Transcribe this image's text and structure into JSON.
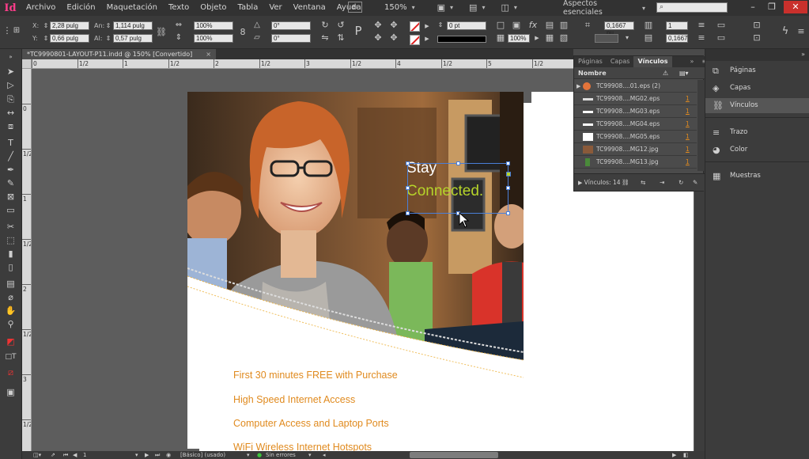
{
  "app": {
    "logo": "Id"
  },
  "menu": [
    "Archivo",
    "Edición",
    "Maquetación",
    "Texto",
    "Objeto",
    "Tabla",
    "Ver",
    "Ventana",
    "Ayuda"
  ],
  "menubar": {
    "bridge_label": "Br",
    "zoom": "150%",
    "workspace": "Aspectos esenciales",
    "search_placeholder": ""
  },
  "window_controls": {
    "minimize": "–",
    "restore": "❐",
    "close": "✕"
  },
  "control": {
    "x_label": "X:",
    "x_value": "2,28 pulg",
    "y_label": "Y:",
    "y_value": "0,66 pulg",
    "w_label": "An:",
    "w_value": "1,114 pulg",
    "h_label": "Al:",
    "h_value": "0,57 pulg",
    "scale_x": "100%",
    "scale_y": "100%",
    "rotate": "0°",
    "shear": "0°",
    "stroke_weight": "0 pt",
    "opacity": "100%",
    "gap": "0,1667 pu",
    "columns": "1",
    "gutter": "0,1667"
  },
  "document": {
    "tab_title": "*TC9990801-LAYOUT-P11.indd @ 150% [Convertido]",
    "tab_close": "×"
  },
  "ruler": {
    "h_labels": [
      "0",
      "1/2",
      "1",
      "1/2",
      "2",
      "1/2",
      "3",
      "1/2",
      "4",
      "1/2",
      "5",
      "1/2"
    ],
    "v_labels": [
      "0",
      "1/2",
      "1",
      "1/2",
      "2",
      "1/2",
      "3",
      "1/2"
    ]
  },
  "artwork": {
    "headline_1": "Stay",
    "headline_2": "Connected.",
    "promo_lines": [
      "First 30 minutes FREE with Purchase",
      "High Speed Internet Access",
      "Computer Access and Laptop Ports",
      "WiFi Wireless Internet Hotspots"
    ],
    "colors": {
      "promo": "#e08a1e",
      "connected": "#b6d42a"
    }
  },
  "links_panel": {
    "tabs": [
      "Páginas",
      "Capas",
      "Vínculos"
    ],
    "active_tab": "Vínculos",
    "expand_icon": "»",
    "menu_icon": "≡",
    "column_header": "Nombre",
    "rows": [
      {
        "name": "TC99908....01.eps (2)",
        "page": ""
      },
      {
        "name": "TC99908....MG02.eps",
        "page": "1"
      },
      {
        "name": "TC99908....MG03.eps",
        "page": "1"
      },
      {
        "name": "TC99908....MG04.eps",
        "page": "1"
      },
      {
        "name": "TC99908....MG05.eps",
        "page": "1"
      },
      {
        "name": "TC99908....MG12.jpg",
        "page": "1"
      },
      {
        "name": "TC99908....MG13.jpg",
        "page": "1"
      }
    ],
    "footer": "Vínculos: 14"
  },
  "right_panel": {
    "items": [
      "Páginas",
      "Capas",
      "Vínculos",
      "Trazo",
      "Color",
      "Muestras"
    ],
    "active": "Vínculos"
  },
  "status": {
    "page": "1",
    "style": "[Básico] (usado)",
    "errors": "Sin errores"
  }
}
